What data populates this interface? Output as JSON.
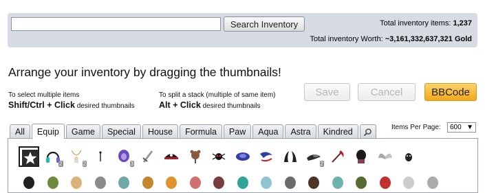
{
  "search": {
    "placeholder": "",
    "button_label": "Search Inventory"
  },
  "stats": {
    "items_label": "Total inventory items:",
    "items_value": "1,237",
    "worth_label": "Total inventory Worth:",
    "worth_value": "~3,161,332,637,321 Gold"
  },
  "arrange": {
    "heading": "Arrange your inventory by dragging the thumbnails!",
    "multi_line1": "To select multiple items",
    "multi_keys": "Shift/Ctrl + Click",
    "multi_rest": "desired thumbnails",
    "split_line1a": "To split a stack",
    "split_line1b": "(multiple of same item)",
    "split_keys": "Alt + Click",
    "split_rest": "desired thumbnails"
  },
  "buttons": {
    "save": "Save",
    "cancel": "Cancel",
    "bbcode": "BBCode"
  },
  "tabs": [
    {
      "label": "All"
    },
    {
      "label": "Equip"
    },
    {
      "label": "Game"
    },
    {
      "label": "Special"
    },
    {
      "label": "House"
    },
    {
      "label": "Formula"
    },
    {
      "label": "Paw"
    },
    {
      "label": "Aqua"
    },
    {
      "label": "Astra"
    },
    {
      "label": "Kindred"
    }
  ],
  "active_tab": "Equip",
  "items_per_page": {
    "label": "Items Per Page:",
    "value": "600"
  },
  "thumbnails": {
    "row1": [
      {
        "icon": "star-icon",
        "qty": ""
      },
      {
        "icon": "headphones-icon",
        "qty": "2"
      },
      {
        "icon": "necklace-icon",
        "qty": "2"
      },
      {
        "icon": "pin-icon",
        "qty": ""
      },
      {
        "icon": "purple-hair-icon",
        "qty": "3"
      },
      {
        "icon": "sword-icon",
        "qty": ""
      },
      {
        "icon": "pirate-hat-icon",
        "qty": ""
      },
      {
        "icon": "bear-plush-icon",
        "qty": ""
      },
      {
        "icon": "spider-icon",
        "qty": ""
      },
      {
        "icon": "blue-creature-icon",
        "qty": ""
      },
      {
        "icon": "blue-tail-icon",
        "qty": ""
      },
      {
        "icon": "black-horns-icon",
        "qty": ""
      },
      {
        "icon": "fur-stole-icon",
        "qty": "2"
      },
      {
        "icon": "red-scythe-icon",
        "qty": ""
      },
      {
        "icon": "dark-hair-icon",
        "qty": ""
      },
      {
        "icon": "grey-wings-icon",
        "qty": ""
      },
      {
        "icon": "small-creature-icon",
        "qty": ""
      }
    ]
  },
  "colors": {
    "accent": "#f2a818",
    "topbar": "#d7dbe3"
  }
}
